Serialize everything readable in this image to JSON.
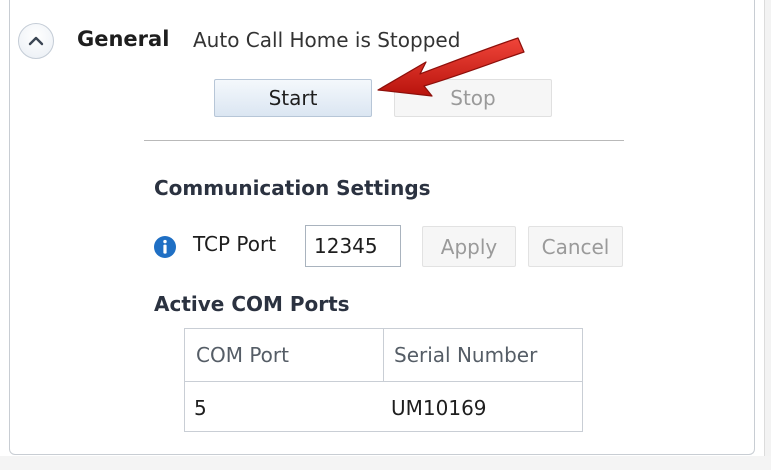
{
  "general": {
    "title": "General",
    "status": "Auto Call Home is Stopped",
    "collapse_icon": "chevron-up-icon",
    "start_label": "Start",
    "stop_label": "Stop"
  },
  "communication": {
    "heading": "Communication Settings",
    "info_icon": "info-icon",
    "tcp_label": "TCP Port",
    "tcp_value": "12345",
    "apply_label": "Apply",
    "cancel_label": "Cancel"
  },
  "active_ports": {
    "heading": "Active COM Ports",
    "columns": [
      "COM Port",
      "Serial Number"
    ],
    "rows": [
      [
        "5",
        "UM10169"
      ]
    ]
  },
  "colors": {
    "arrow": "#d9261c",
    "info": "#1f6fc4"
  }
}
